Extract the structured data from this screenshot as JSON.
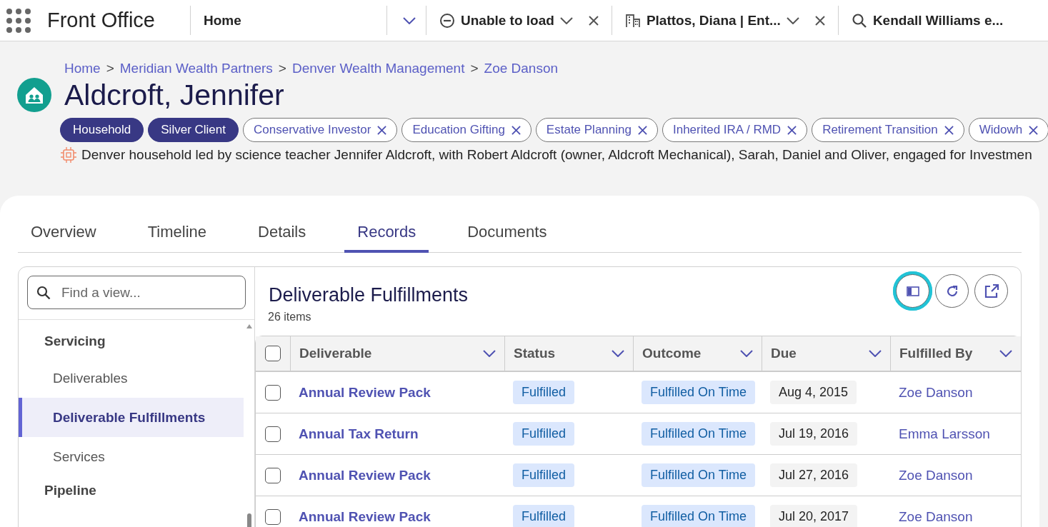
{
  "app": {
    "title": "Front Office"
  },
  "top_tabs": [
    {
      "kind": "home",
      "label": "Home",
      "closable": false
    },
    {
      "kind": "error",
      "label": "Unable to load",
      "closable": true
    },
    {
      "kind": "entity",
      "label": "Plattos, Diana | Ent...",
      "closable": true
    },
    {
      "kind": "search",
      "label": "Kendall Williams e...",
      "closable": false
    }
  ],
  "breadcrumb": [
    {
      "kind": "link",
      "text": "Home"
    },
    {
      "kind": "separator",
      "text": ">"
    },
    {
      "kind": "link",
      "text": "Meridian Wealth Partners"
    },
    {
      "kind": "separator",
      "text": ">"
    },
    {
      "kind": "link",
      "text": "Denver Wealth Management"
    },
    {
      "kind": "separator",
      "text": ">"
    },
    {
      "kind": "link",
      "text": "Zoe Danson"
    }
  ],
  "record": {
    "title": "Aldcroft, Jennifer",
    "description": "Denver household led by science teacher Jennifer Aldcroft, with Robert Aldcroft (owner, Aldcroft Mechanical), Sarah, Daniel and Oliver, engaged for Investmen"
  },
  "tags": [
    {
      "label": "Household",
      "kind": "primary"
    },
    {
      "label": "Silver Client",
      "kind": "primary"
    },
    {
      "label": "Conservative Investor",
      "kind": "removable"
    },
    {
      "label": "Education Gifting",
      "kind": "removable"
    },
    {
      "label": "Estate Planning",
      "kind": "removable"
    },
    {
      "label": "Inherited IRA / RMD",
      "kind": "removable"
    },
    {
      "label": "Retirement Transition",
      "kind": "removable"
    },
    {
      "label": "Widowh",
      "kind": "removable"
    }
  ],
  "tabs": [
    {
      "label": "Overview",
      "selected": false
    },
    {
      "label": "Timeline",
      "selected": false
    },
    {
      "label": "Details",
      "selected": false
    },
    {
      "label": "Records",
      "selected": true
    },
    {
      "label": "Documents",
      "selected": false
    }
  ],
  "sidebar": {
    "search": {
      "placeholder": "Find a view..."
    },
    "items": [
      {
        "kind": "header",
        "label": "Servicing",
        "selected": false
      },
      {
        "kind": "item",
        "label": "Deliverables",
        "selected": false
      },
      {
        "kind": "item",
        "label": "Deliverable Fulfillments",
        "selected": true
      },
      {
        "kind": "item",
        "label": "Services",
        "selected": false
      },
      {
        "kind": "header",
        "label": "Pipeline",
        "selected": false
      }
    ]
  },
  "view": {
    "title": "Deliverable Fulfillments",
    "count": "26 items",
    "toolbar": [
      {
        "kind": "panel",
        "focused": true
      },
      {
        "kind": "refresh",
        "focused": false
      },
      {
        "kind": "open",
        "focused": false
      }
    ]
  },
  "table": {
    "select_all_checked": false,
    "columns": [
      "Deliverable",
      "Status",
      "Outcome",
      "Due",
      "Fulfilled By"
    ],
    "rows": [
      {
        "checked": false,
        "deliverable": "Annual Review Pack",
        "status": "Fulfilled",
        "outcome": "Fulfilled On Time",
        "due": "Aug 4, 2015",
        "fulfilled_by": "Zoe Danson"
      },
      {
        "checked": false,
        "deliverable": "Annual Tax Return",
        "status": "Fulfilled",
        "outcome": "Fulfilled On Time",
        "due": "Jul 19, 2016",
        "fulfilled_by": "Emma Larsson"
      },
      {
        "checked": false,
        "deliverable": "Annual Review Pack",
        "status": "Fulfilled",
        "outcome": "Fulfilled On Time",
        "due": "Jul 27, 2016",
        "fulfilled_by": "Zoe Danson"
      },
      {
        "checked": false,
        "deliverable": "Annual Review Pack",
        "status": "Fulfilled",
        "outcome": "Fulfilled On Time",
        "due": "Jul 20, 2017",
        "fulfilled_by": "Zoe Danson"
      }
    ]
  }
}
